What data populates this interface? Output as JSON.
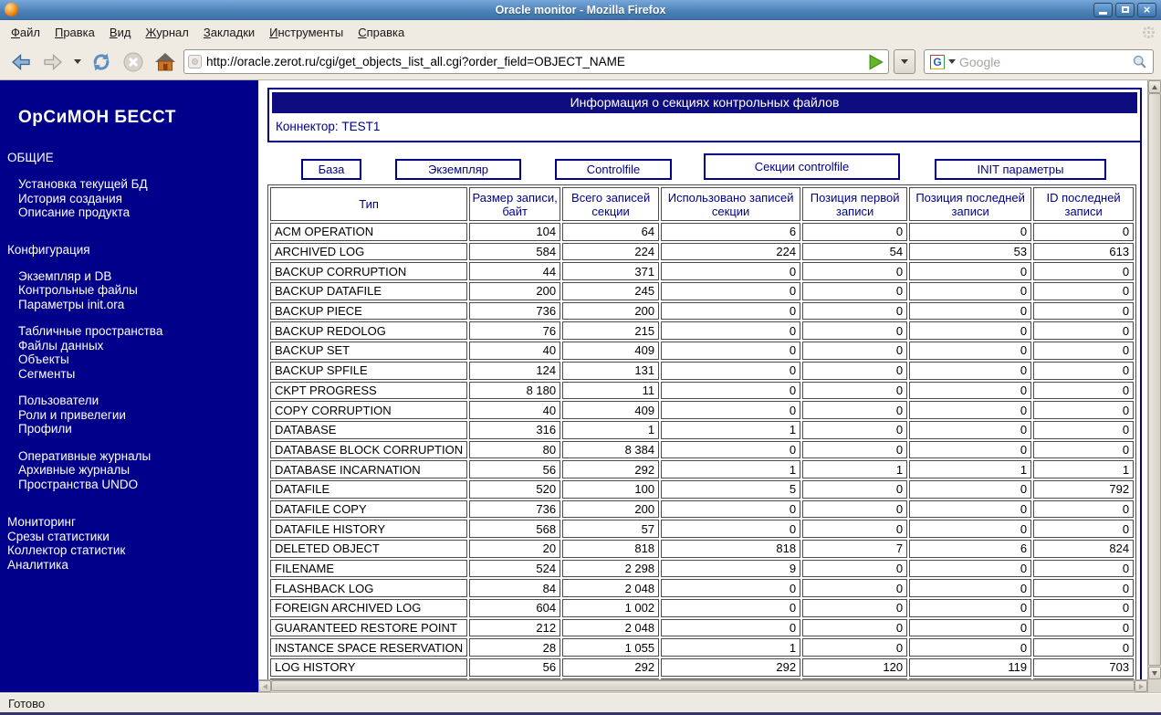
{
  "window": {
    "title": "Oracle monitor - Mozilla Firefox"
  },
  "menubar": {
    "items": [
      "Файл",
      "Правка",
      "Вид",
      "Журнал",
      "Закладки",
      "Инструменты",
      "Справка"
    ]
  },
  "toolbar": {
    "url": "http://oracle.zerot.ru/cgi/get_objects_list_all.cgi?order_field=OBJECT_NAME",
    "search_placeholder": "Google",
    "icons": [
      "back-icon",
      "forward-icon",
      "reload-icon",
      "stop-icon",
      "home-icon",
      "go-icon",
      "google-icon",
      "magnifier-icon"
    ]
  },
  "sidebar": {
    "brand": "ОрСиМОН БЕССТ",
    "sections": [
      {
        "type": "heading",
        "text": "ОБЩИЕ"
      },
      {
        "type": "links",
        "items": [
          "Установка текущей БД",
          "История создания",
          "Описание продукта"
        ]
      },
      {
        "type": "heading",
        "text": "Конфигурация"
      },
      {
        "type": "links",
        "items": [
          "Экземпляр и DB",
          "Контрольные файлы",
          "Параметры init.ora"
        ]
      },
      {
        "type": "links",
        "items": [
          "Табличные пространства",
          "Файлы данных",
          "Объекты",
          "Сегменты"
        ]
      },
      {
        "type": "links",
        "items": [
          "Пользователи",
          "Роли и привелегии",
          "Профили"
        ]
      },
      {
        "type": "links",
        "items": [
          "Оперативные журналы",
          "Архивные журналы",
          "Пространства UNDO"
        ]
      },
      {
        "type": "rootlinks",
        "items": [
          "Мониторинг",
          "Срезы статистики",
          "Коллектор статистик",
          "Аналитика"
        ]
      }
    ]
  },
  "main": {
    "page_title": "Информация о секциях контрольных файлов",
    "connector_label": "Коннектор: TEST1",
    "tabs": [
      {
        "label": "База",
        "active": false
      },
      {
        "label": "Экземпляр",
        "active": false
      },
      {
        "label": "Controlfile",
        "active": false
      },
      {
        "label": "Секции controlfile",
        "active": true
      },
      {
        "label": "INIT параметры",
        "active": false
      }
    ],
    "table": {
      "headers": [
        "Тип",
        "Размер записи, байт",
        "Всего записей секции",
        "Использовано записей секции",
        "Позиция первой записи",
        "Позиция последней записи",
        "ID последней записи"
      ],
      "rows": [
        [
          "ACM OPERATION",
          "104",
          "64",
          "6",
          "0",
          "0",
          "0"
        ],
        [
          "ARCHIVED LOG",
          "584",
          "224",
          "224",
          "54",
          "53",
          "613"
        ],
        [
          "BACKUP CORRUPTION",
          "44",
          "371",
          "0",
          "0",
          "0",
          "0"
        ],
        [
          "BACKUP DATAFILE",
          "200",
          "245",
          "0",
          "0",
          "0",
          "0"
        ],
        [
          "BACKUP PIECE",
          "736",
          "200",
          "0",
          "0",
          "0",
          "0"
        ],
        [
          "BACKUP REDOLOG",
          "76",
          "215",
          "0",
          "0",
          "0",
          "0"
        ],
        [
          "BACKUP SET",
          "40",
          "409",
          "0",
          "0",
          "0",
          "0"
        ],
        [
          "BACKUP SPFILE",
          "124",
          "131",
          "0",
          "0",
          "0",
          "0"
        ],
        [
          "CKPT PROGRESS",
          "8 180",
          "11",
          "0",
          "0",
          "0",
          "0"
        ],
        [
          "COPY CORRUPTION",
          "40",
          "409",
          "0",
          "0",
          "0",
          "0"
        ],
        [
          "DATABASE",
          "316",
          "1",
          "1",
          "0",
          "0",
          "0"
        ],
        [
          "DATABASE BLOCK CORRUPTION",
          "80",
          "8 384",
          "0",
          "0",
          "0",
          "0"
        ],
        [
          "DATABASE INCARNATION",
          "56",
          "292",
          "1",
          "1",
          "1",
          "1"
        ],
        [
          "DATAFILE",
          "520",
          "100",
          "5",
          "0",
          "0",
          "792"
        ],
        [
          "DATAFILE COPY",
          "736",
          "200",
          "0",
          "0",
          "0",
          "0"
        ],
        [
          "DATAFILE HISTORY",
          "568",
          "57",
          "0",
          "0",
          "0",
          "0"
        ],
        [
          "DELETED OBJECT",
          "20",
          "818",
          "818",
          "7",
          "6",
          "824"
        ],
        [
          "FILENAME",
          "524",
          "2 298",
          "9",
          "0",
          "0",
          "0"
        ],
        [
          "FLASHBACK LOG",
          "84",
          "2 048",
          "0",
          "0",
          "0",
          "0"
        ],
        [
          "FOREIGN ARCHIVED LOG",
          "604",
          "1 002",
          "0",
          "0",
          "0",
          "0"
        ],
        [
          "GUARANTEED RESTORE POINT",
          "212",
          "2 048",
          "0",
          "0",
          "0",
          "0"
        ],
        [
          "INSTANCE SPACE RESERVATION",
          "28",
          "1 055",
          "1",
          "0",
          "0",
          "0"
        ],
        [
          "LOG HISTORY",
          "56",
          "292",
          "292",
          "120",
          "119",
          "703"
        ]
      ]
    }
  },
  "statusbar": {
    "text": "Готово"
  },
  "colors": {
    "accent_navy": "#000088",
    "sidebar_bg": "#00008b",
    "titlebar_blue": "#4b80b6",
    "chrome_bg": "#efebe2",
    "go_green": "#63b926"
  }
}
